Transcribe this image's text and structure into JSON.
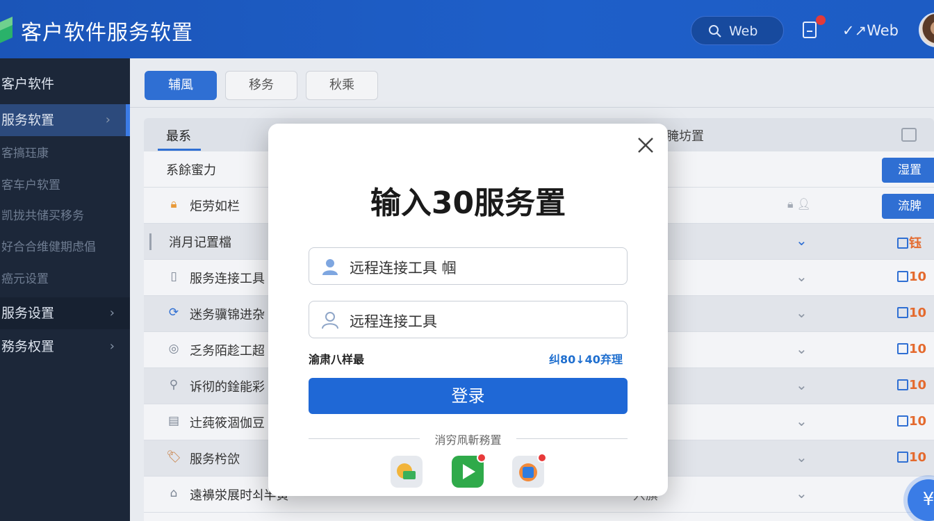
{
  "header": {
    "app_title": "客户软件服务软置",
    "search_label": "Web",
    "web_link": "✓↗Web",
    "notification_count": "1"
  },
  "sidebar": {
    "items": [
      {
        "label": "客户软件"
      },
      {
        "label": "服务软置"
      },
      {
        "label": "客搞珏康"
      },
      {
        "label": "客车户软置"
      },
      {
        "label": "凯拢共储买移务"
      },
      {
        "label": "好合合维健期虑倡"
      },
      {
        "label": "癌元设置"
      },
      {
        "label": "服务设置"
      },
      {
        "label": "務务权置"
      }
    ]
  },
  "toolbar": {
    "tabs": [
      {
        "label": "辅風"
      },
      {
        "label": "移务"
      },
      {
        "label": "秋乘"
      }
    ]
  },
  "table": {
    "header_col1": "最系",
    "header_col3": "腌坊置",
    "rows": [
      {
        "text": "系餘蜜力",
        "button": "湿置"
      },
      {
        "text": "炬劳如栏",
        "button": "流脾"
      },
      {
        "text": "消月记置檔",
        "badge": "钰"
      },
      {
        "text": "服务连接工具",
        "badge": "10"
      },
      {
        "text": "迷务骥锦进杂",
        "badge": "10"
      },
      {
        "text": "乏务陌趁工超",
        "badge": "10"
      },
      {
        "text": "诉彻的鍂能彩",
        "badge": "10"
      },
      {
        "text": "辻莼筱涸伽豆",
        "badge": "10"
      },
      {
        "text": "服务枍欱",
        "badge": "10"
      },
      {
        "text": "遠襣泶展时쇠半黄",
        "extra": "宍旗"
      }
    ]
  },
  "modal": {
    "title": "输入30服务置",
    "username_value": "远程连接工具 帼",
    "password_value": "远程连接工具",
    "remember_label": "渝肃八样最",
    "forgot_label": "纠80↓40弃理",
    "login_button": "登录",
    "divider_text": "消穷凧斬務置"
  },
  "fab_label": "¥",
  "colors": {
    "header_blue": "#1e5fc9",
    "primary": "#1f68d6",
    "sidebar_bg": "#1c2739",
    "badge_orange": "#e46a2e"
  }
}
